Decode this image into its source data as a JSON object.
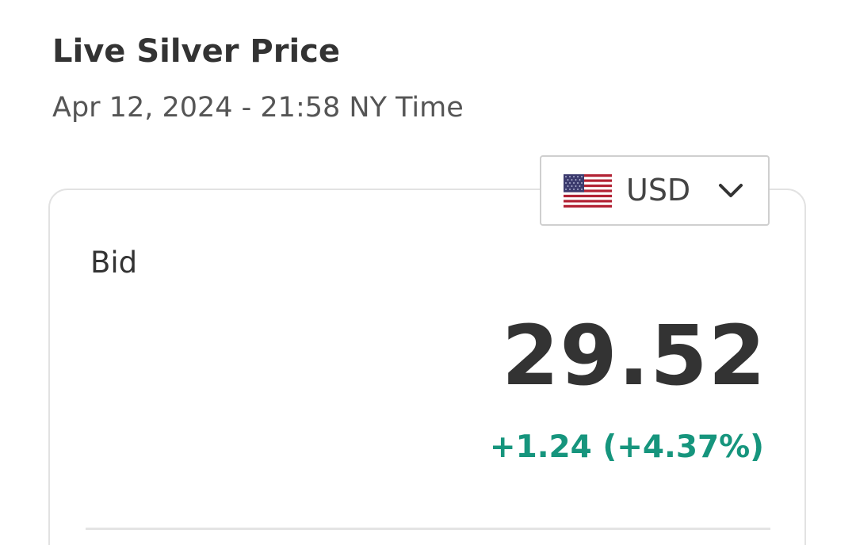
{
  "header": {
    "title": "Live Silver Price",
    "timestamp": "Apr 12, 2024 - 21:58 NY Time"
  },
  "currency_selector": {
    "selected": "USD",
    "flag_icon": "us-flag-icon",
    "chevron_icon": "chevron-down-icon"
  },
  "quote": {
    "label": "Bid",
    "price": "29.52",
    "change": "+1.24 (+4.37%)",
    "change_color": "#16957d"
  }
}
